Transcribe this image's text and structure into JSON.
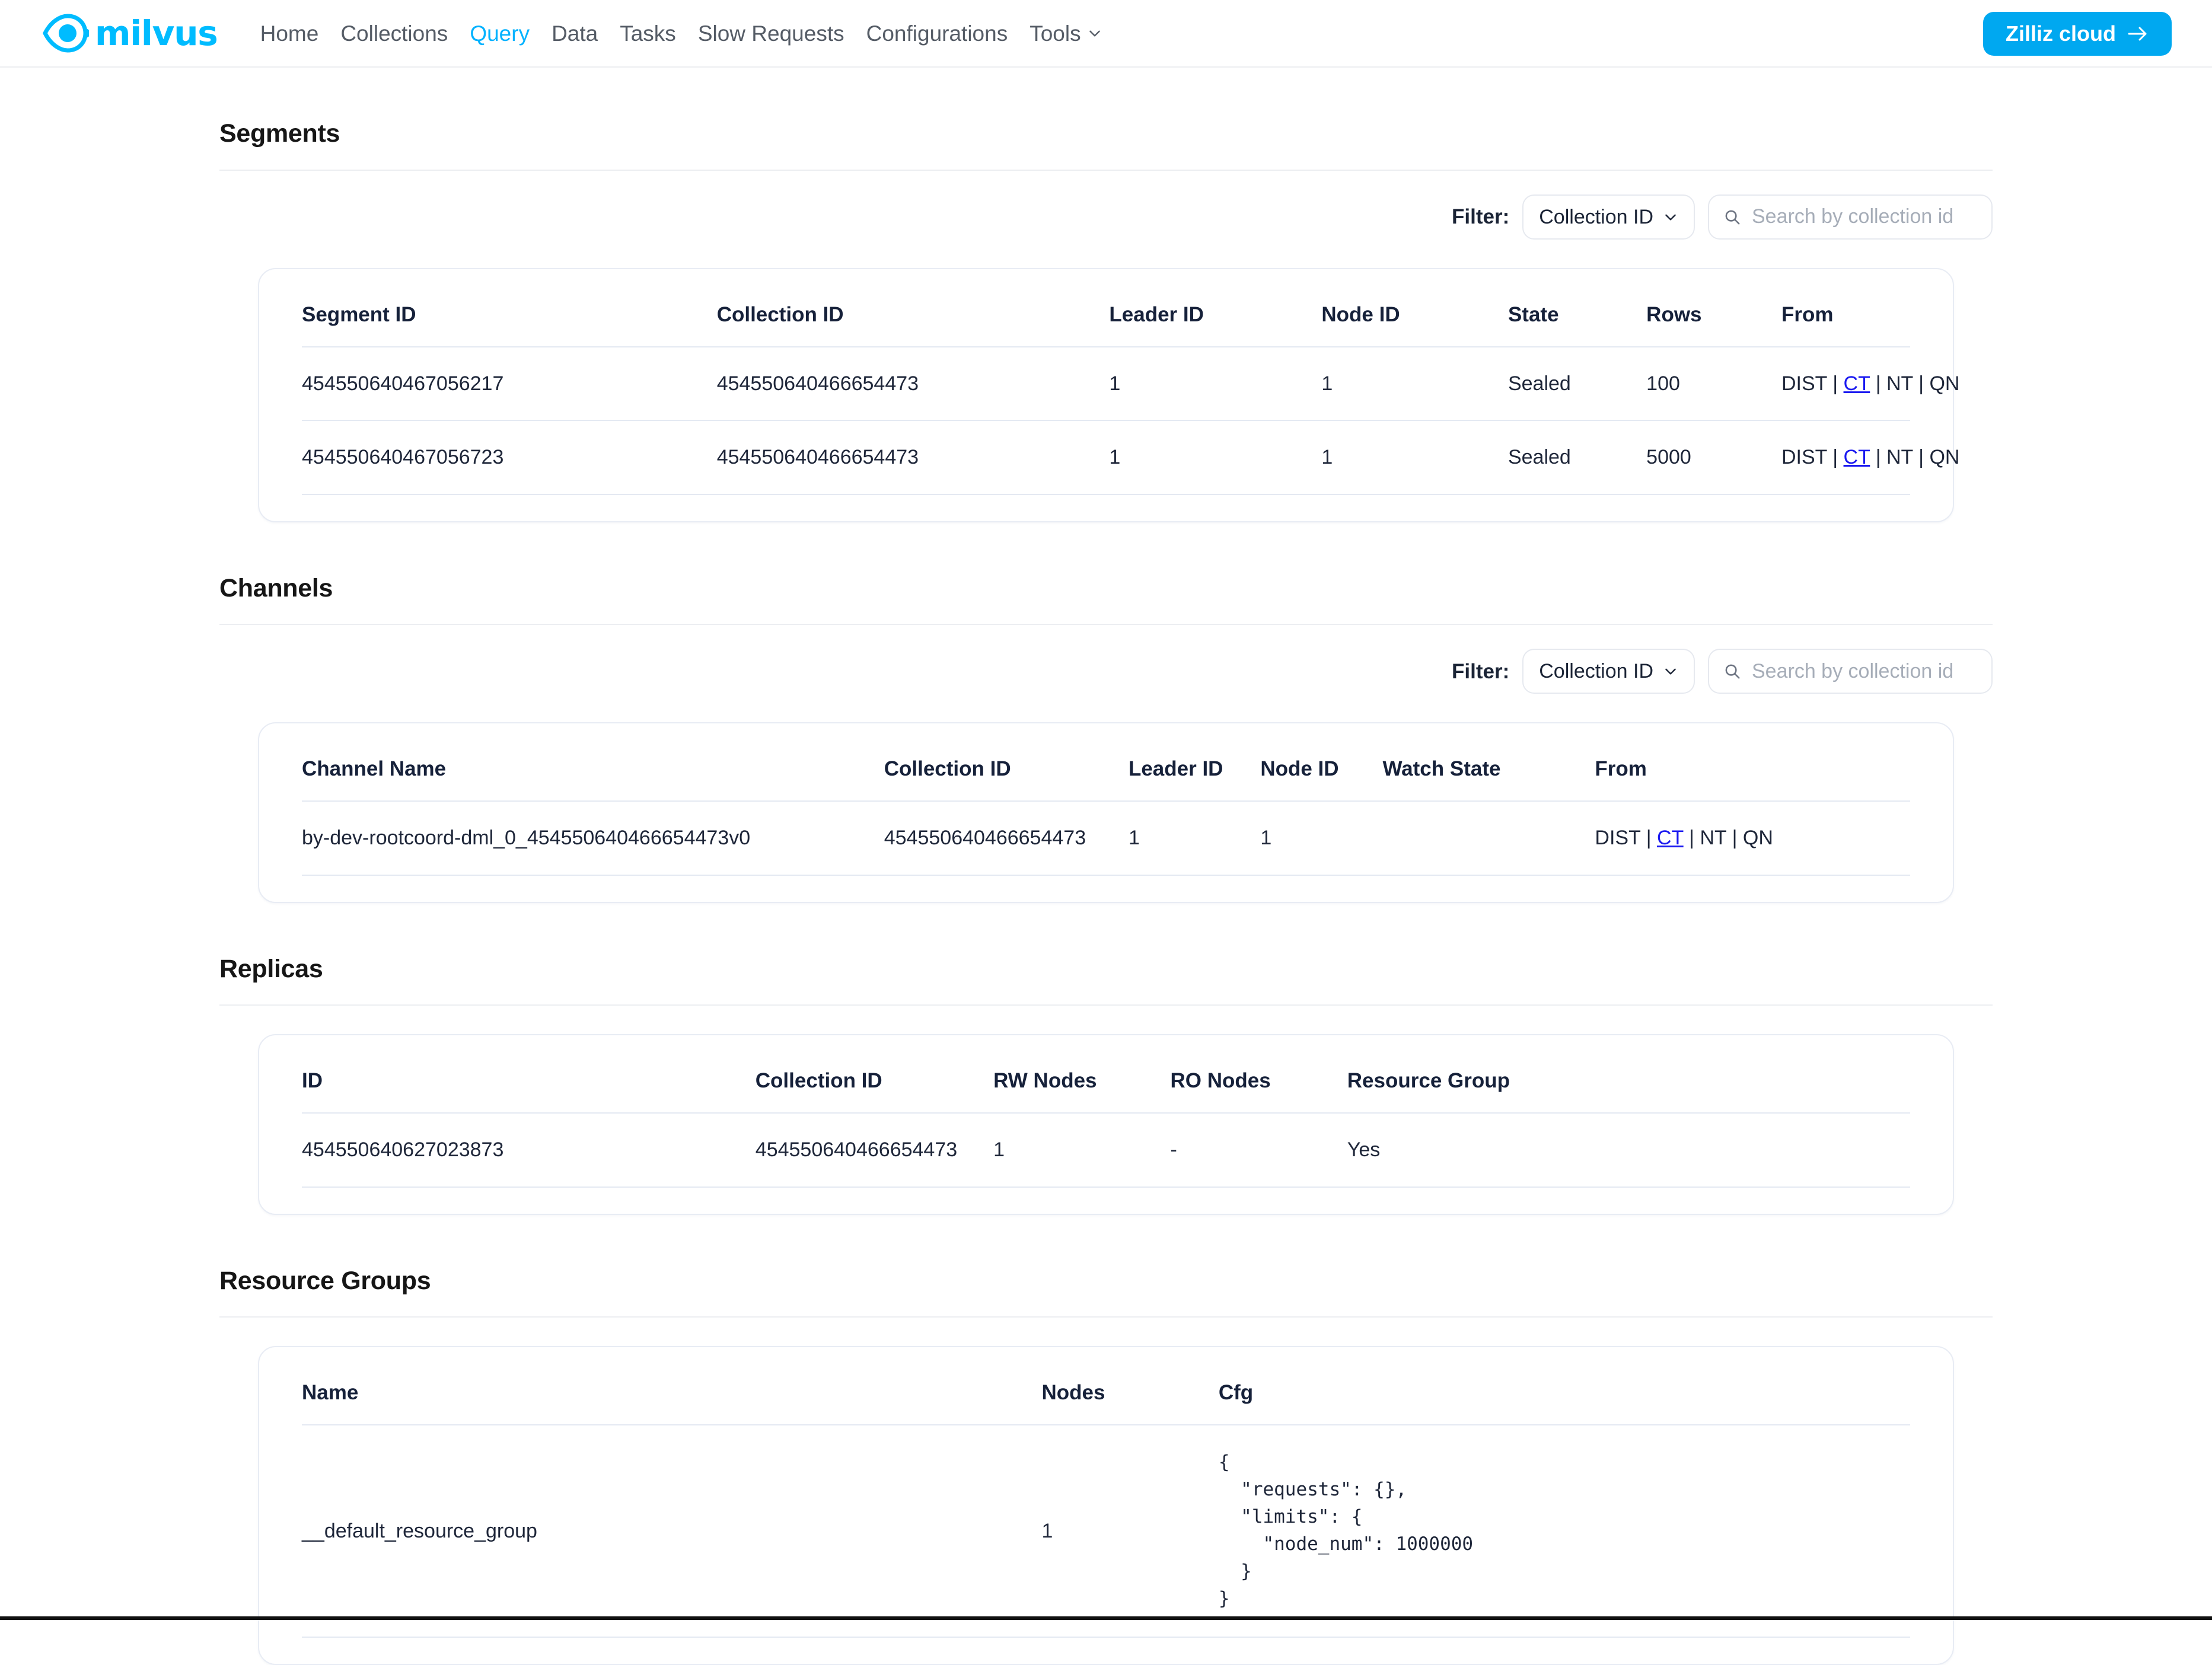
{
  "header": {
    "brand_name": "milvus",
    "brand_color": "#00bcff",
    "nav_items": [
      {
        "label": "Home",
        "active": false,
        "caret": false
      },
      {
        "label": "Collections",
        "active": false,
        "caret": false
      },
      {
        "label": "Query",
        "active": true,
        "caret": false
      },
      {
        "label": "Data",
        "active": false,
        "caret": false
      },
      {
        "label": "Tasks",
        "active": false,
        "caret": false
      },
      {
        "label": "Slow Requests",
        "active": false,
        "caret": false
      },
      {
        "label": "Configurations",
        "active": false,
        "caret": false
      },
      {
        "label": "Tools",
        "active": false,
        "caret": true
      }
    ],
    "cloud_button_label": "Zilliz cloud",
    "cloud_button_color": "#00a8f0"
  },
  "sections": {
    "segments": {
      "title": "Segments",
      "filter": {
        "label": "Filter:",
        "select_value": "Collection ID",
        "search_placeholder": "Search by collection id",
        "search_value": ""
      },
      "columns": [
        "Segment ID",
        "Collection ID",
        "Leader ID",
        "Node ID",
        "State",
        "Rows",
        "From"
      ],
      "rows": [
        {
          "segment_id": "454550640467056217",
          "collection_id": "454550640466654473",
          "leader_id": "1",
          "node_id": "1",
          "state": "Sealed",
          "rows": "100",
          "from": {
            "dist": "DIST",
            "ct": "CT",
            "nt": "NT",
            "qn": "QN"
          }
        },
        {
          "segment_id": "454550640467056723",
          "collection_id": "454550640466654473",
          "leader_id": "1",
          "node_id": "1",
          "state": "Sealed",
          "rows": "5000",
          "from": {
            "dist": "DIST",
            "ct": "CT",
            "nt": "NT",
            "qn": "QN"
          }
        }
      ]
    },
    "channels": {
      "title": "Channels",
      "filter": {
        "label": "Filter:",
        "select_value": "Collection ID",
        "search_placeholder": "Search by collection id",
        "search_value": ""
      },
      "columns": [
        "Channel Name",
        "Collection ID",
        "Leader ID",
        "Node ID",
        "Watch State",
        "From"
      ],
      "rows": [
        {
          "channel_name": "by-dev-rootcoord-dml_0_454550640466654473v0",
          "collection_id": "454550640466654473",
          "leader_id": "1",
          "node_id": "1",
          "watch_state": "",
          "from": {
            "dist": "DIST",
            "ct": "CT",
            "nt": "NT",
            "qn": "QN"
          }
        }
      ]
    },
    "replicas": {
      "title": "Replicas",
      "columns": [
        "ID",
        "Collection ID",
        "RW Nodes",
        "RO Nodes",
        "Resource Group"
      ],
      "rows": [
        {
          "id": "454550640627023873",
          "collection_id": "454550640466654473",
          "rw_nodes": "1",
          "ro_nodes": "-",
          "resource_group": "Yes"
        }
      ]
    },
    "resource_groups": {
      "title": "Resource Groups",
      "columns": [
        "Name",
        "Nodes",
        "Cfg"
      ],
      "rows": [
        {
          "name": "__default_resource_group",
          "nodes": "1",
          "cfg": "{\n  \"requests\": {},\n  \"limits\": {\n    \"node_num\": 1000000\n  }\n}"
        }
      ]
    }
  },
  "icons": {
    "search": "search-icon",
    "chevron_down": "chevron-down-icon",
    "arrow_right": "arrow-right-icon",
    "logo": "milvus-logo-icon"
  }
}
